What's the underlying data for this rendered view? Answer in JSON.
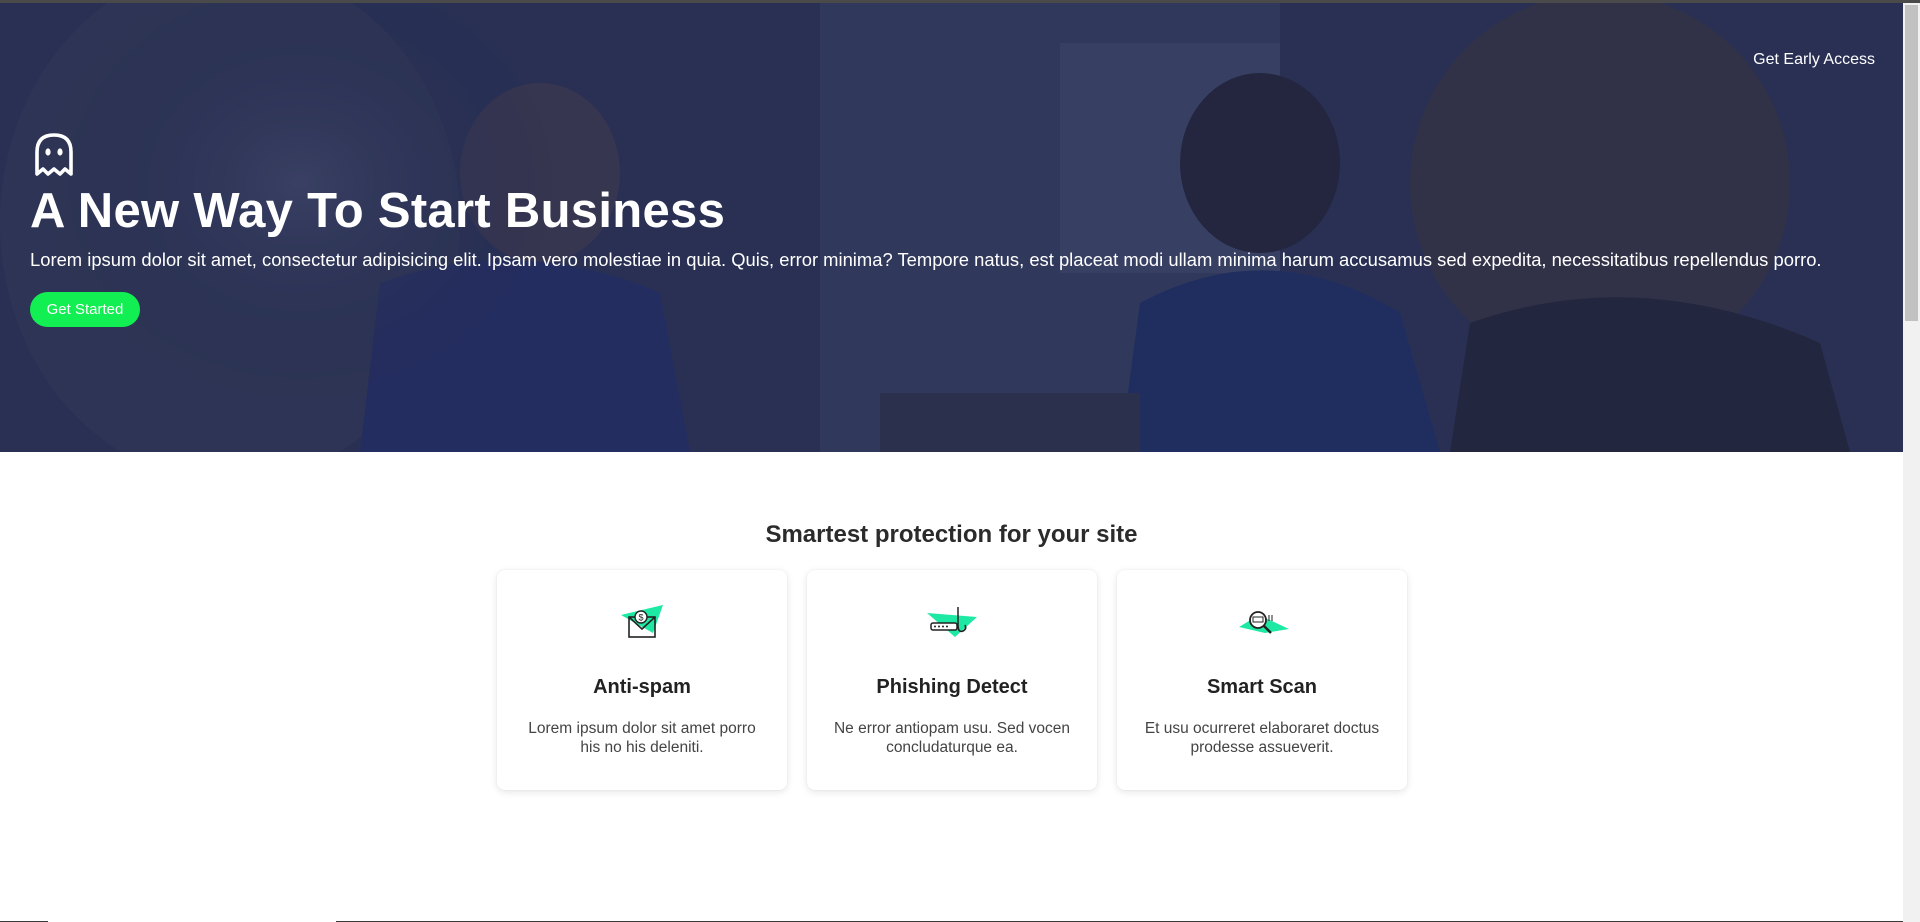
{
  "nav": {
    "early_access_label": "Get Early Access"
  },
  "hero": {
    "logo_icon": "ghost-icon",
    "title": "A New Way To Start Business",
    "text": "Lorem ipsum dolor sit amet, consectetur adipisicing elit. Ipsam vero molestiae in quia. Quis, error minima? Tempore natus, est placeat modi ullam minima harum accusamus sed expedita, necessitatibus repellendus porro.",
    "cta_label": "Get Started"
  },
  "features": {
    "title": "Smartest protection for your site",
    "cards": [
      {
        "icon": "spam-envelope-icon",
        "title": "Anti-spam",
        "description": "Lorem ipsum dolor sit amet porro his no his deleniti."
      },
      {
        "icon": "phishing-hook-icon",
        "title": "Phishing Detect",
        "description": "Ne error antiopam usu. Sed vocen concludaturque ea."
      },
      {
        "icon": "magnifier-scan-icon",
        "title": "Smart Scan",
        "description": "Et usu ocurreret elaboraret doctus prodesse assueverit."
      }
    ]
  },
  "colors": {
    "accent": "#11ef52",
    "hero_overlay": "#1b224a",
    "icon_accent": "#1de9a4"
  }
}
